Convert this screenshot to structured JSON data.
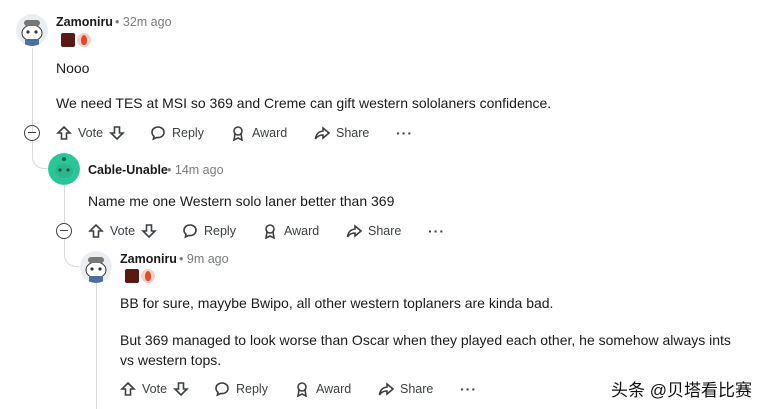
{
  "comments": [
    {
      "user": "Zamoniru",
      "time": "32m ago",
      "paragraphs": [
        "Nooo",
        "We need TES at MSI so 369 and Creme can gift western sololaners confidence."
      ],
      "avatar": "snoo-avatar-a"
    },
    {
      "user": "Cable-Unable",
      "time": "14m ago",
      "paragraphs": [
        "Name me one Western solo laner better than 369"
      ],
      "avatar": "snoo-avatar-green"
    },
    {
      "user": "Zamoniru",
      "time": "9m ago",
      "paragraphs": [
        "BB for sure, mayybe Bwipo, all other western toplaners are kinda bad.",
        "But 369 managed to look worse than Oscar when they played each other, he somehow always ints vs western tops."
      ],
      "avatar": "snoo-avatar-a"
    }
  ],
  "actions": {
    "vote": "Vote",
    "reply": "Reply",
    "award": "Award",
    "share": "Share",
    "more": "···",
    "separator": "•"
  },
  "watermark": "头条 @贝塔看比赛"
}
